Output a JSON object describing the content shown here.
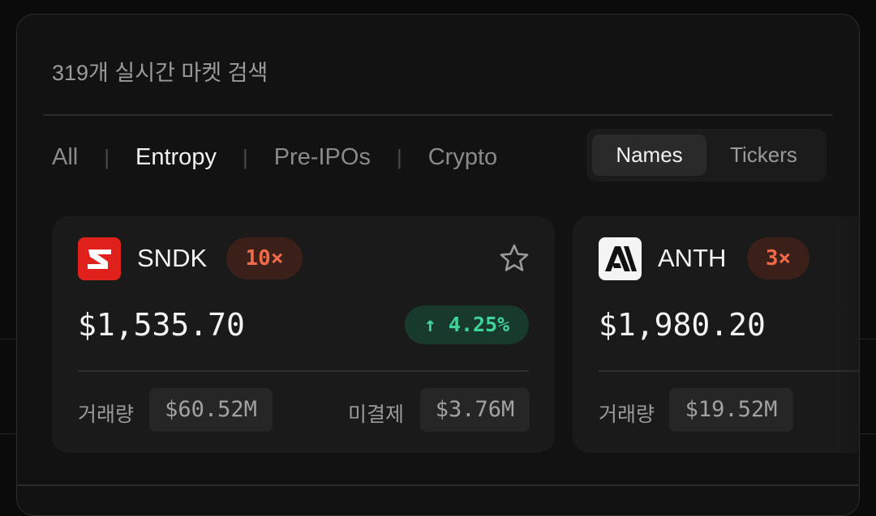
{
  "search": {
    "placeholder": "319개 실시간 마켓 검색"
  },
  "filters": [
    "All",
    "Entropy",
    "Pre-IPOs",
    "Crypto"
  ],
  "active_filter": "Entropy",
  "separator": "|",
  "view_toggle": {
    "names": "Names",
    "tickers": "Tickers",
    "active": "Names"
  },
  "markets": [
    {
      "ticker": "SNDK",
      "leverage": "10×",
      "price": "$1,535.70",
      "change": "4.25%",
      "change_arrow": "↑",
      "volume_label": "거래량",
      "volume": "$60.52M",
      "open_interest_label": "미결제",
      "open_interest": "$3.76M",
      "logo_icon": "sndk-logo-icon",
      "logo_color": "#e0201a"
    },
    {
      "ticker": "ANTH",
      "leverage": "3×",
      "price": "$1,980.20",
      "volume_label": "거래량",
      "volume": "$19.52M",
      "logo_icon": "anthropic-logo-icon",
      "logo_color": "#f4f4f4"
    }
  ],
  "colors": {
    "background": "#0b0b0b",
    "panel": "#121212",
    "card": "#1a1a1a",
    "leverage_text": "#f06a4a",
    "positive": "#3fd49a"
  }
}
